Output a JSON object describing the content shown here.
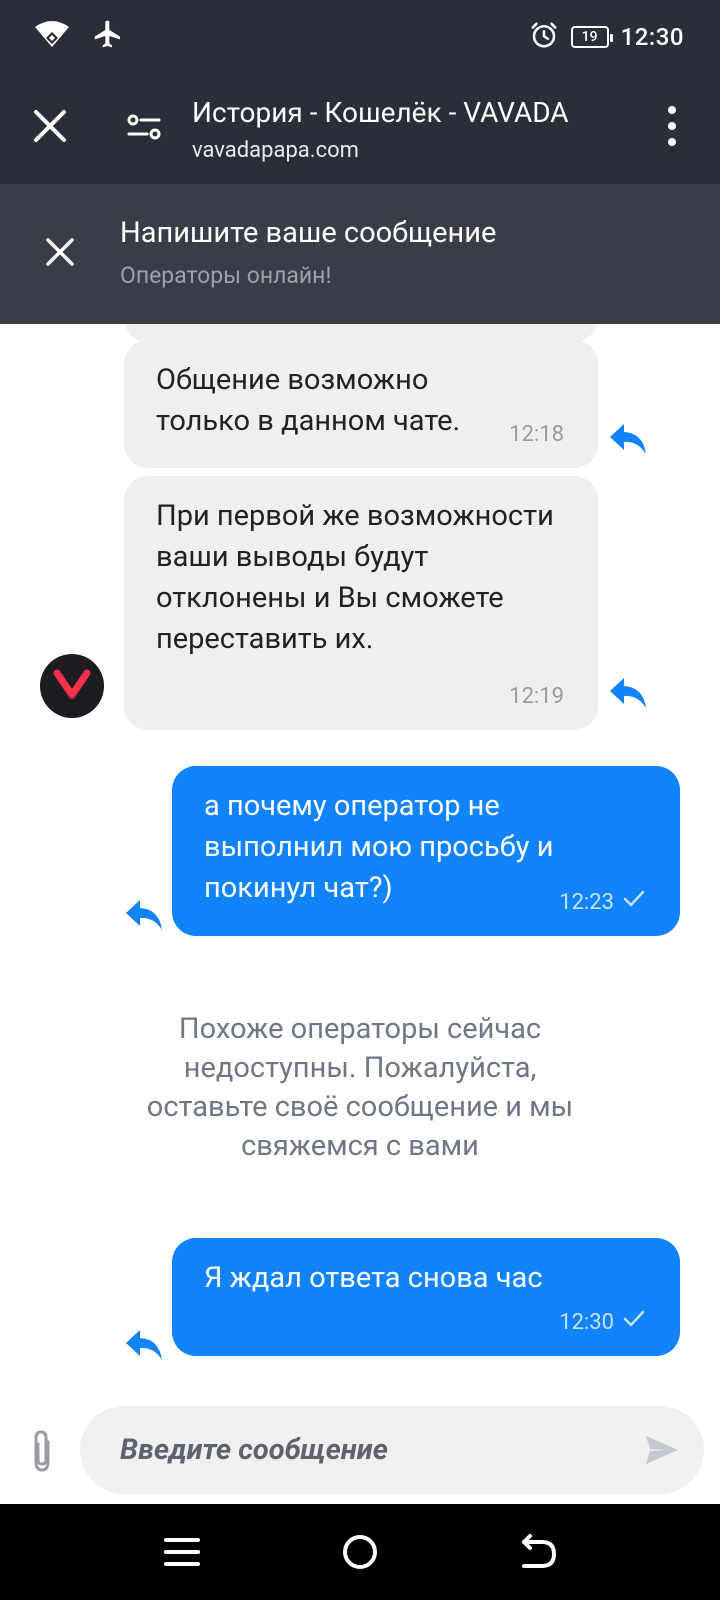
{
  "status_bar": {
    "time": "12:30",
    "battery": "19",
    "icons": [
      "wifi-icon",
      "airplane-icon",
      "alarm-icon",
      "battery-icon"
    ]
  },
  "browser": {
    "title": "История - Кошелёк - VAVADA",
    "url": "vavadapapa.com"
  },
  "chat_header": {
    "title": "Напишите ваше сообщение",
    "subtitle": "Операторы онлайн!"
  },
  "messages": [
    {
      "direction": "in",
      "text": "Общение возможно только в данном чате.",
      "time": "12:18"
    },
    {
      "direction": "in",
      "text": "При первой же возможности ваши выводы будут отклонены и Вы сможете переставить их.",
      "time": "12:19"
    },
    {
      "direction": "out",
      "text": "а почему оператор не выполнил мою просьбу и покинул чат?)",
      "time": "12:23"
    },
    {
      "direction": "system",
      "text": "Похоже операторы сейчас недоступны. Пожалуйста, оставьте своё сообщение и мы свяжемся с вами"
    },
    {
      "direction": "out",
      "text": "Я ждал ответа снова час",
      "time": "12:30"
    }
  ],
  "composer": {
    "placeholder": "Введите сообщение"
  },
  "colors": {
    "toolbar": "#2b2e38",
    "chat_header": "#3a3d47",
    "outgoing_bubble": "#1183fb",
    "incoming_bubble": "#efefef",
    "reply_icon": "#1183fb",
    "avatar_logo": "#f5304b"
  }
}
